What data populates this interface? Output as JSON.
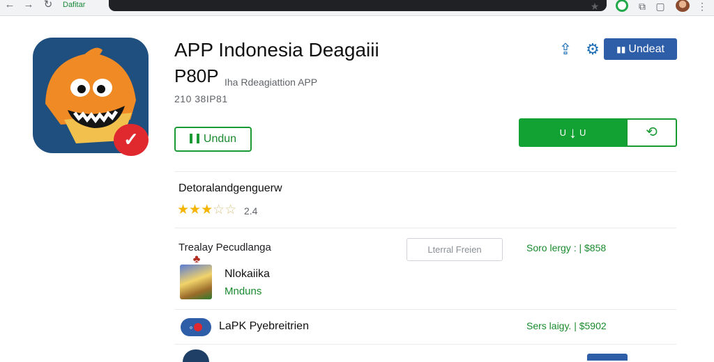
{
  "browser": {
    "back_icon": "←",
    "forward_icon": "→",
    "reload_icon": "↻",
    "site_label": "Dafitar",
    "star_icon": "★",
    "tab_icon": "▢",
    "menu_icon": "⋮"
  },
  "app": {
    "title": "APP Indonesia Deagaiii",
    "subtitle": "P80P",
    "developer": "Iha Rdeagiattion APP",
    "version": "210 38IP81",
    "install_label": "Undun",
    "badge_icon": "✓"
  },
  "actions": {
    "share_icon": "⇪",
    "gear_icon": "⚙",
    "update_label": "Undeat",
    "update_icon": "▮▮",
    "download_label": "U↓",
    "download_arrow": "↓",
    "download_suffix": "U",
    "install_icon": "⟲"
  },
  "rating": {
    "title": "Detoralandgenguerw",
    "stars_on": "★★★",
    "stars_off": "☆☆",
    "value": "2.4"
  },
  "similar": {
    "title": "Trealay Pecudlanga",
    "filter_label": "Lterral Freien",
    "items": [
      {
        "name": "Nlokaiika",
        "sub": "Mnduns",
        "size": "Soro lergy : | $858"
      },
      {
        "name": "LaPK Pyebreitrien",
        "sub": "",
        "size": "Sers laigy. | $5902"
      }
    ]
  },
  "colors": {
    "accent_green": "#12a133",
    "accent_blue": "#2f5ea8",
    "star_gold": "#f4b400",
    "badge_red": "#e0282f"
  }
}
